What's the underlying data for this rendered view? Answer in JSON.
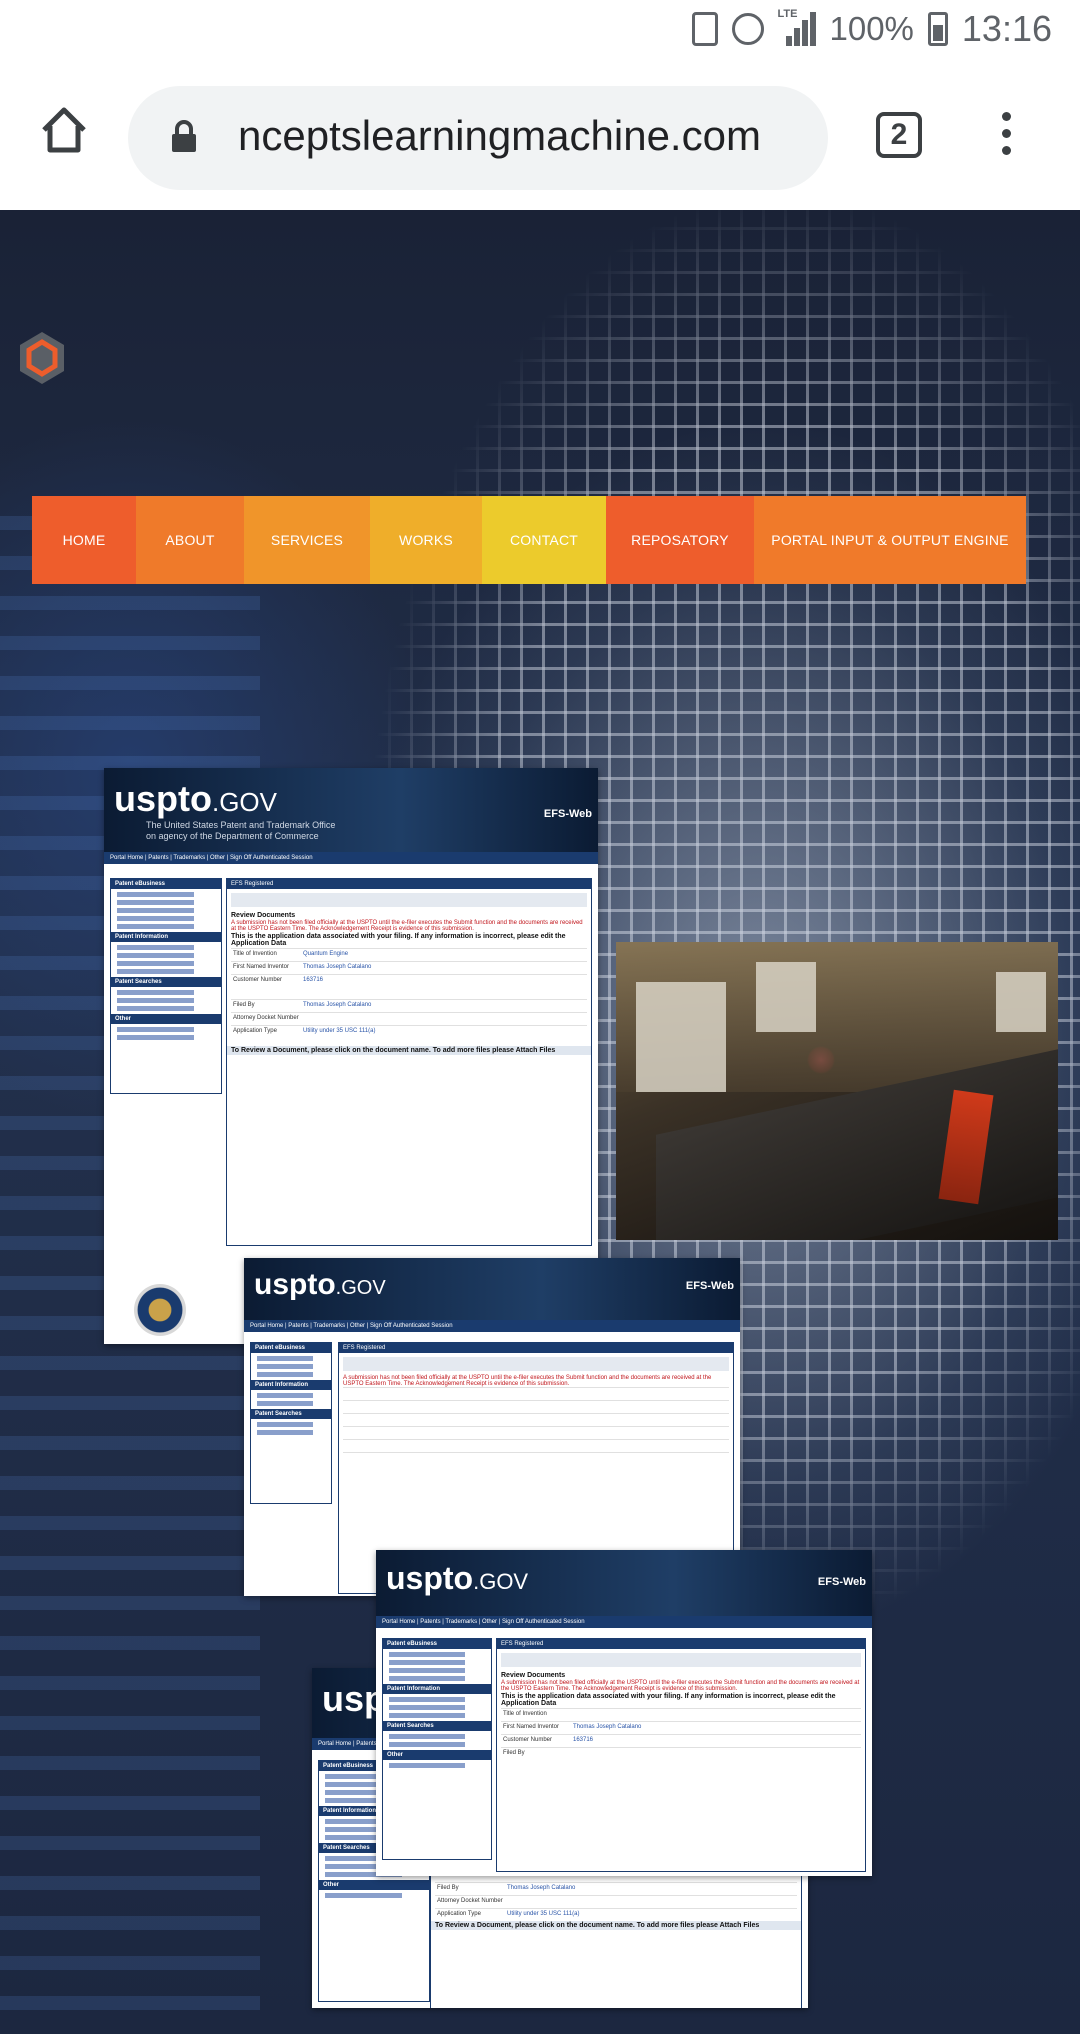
{
  "status_bar": {
    "lte_label": "LTE",
    "battery_pct": "100%",
    "time": "13:16"
  },
  "browser": {
    "url": "nceptslearningmachine.com",
    "tab_count": "2"
  },
  "nav": {
    "items": [
      {
        "label": "HOME",
        "color": "#ee5d2c"
      },
      {
        "label": "ABOUT",
        "color": "#ef7a2a"
      },
      {
        "label": "SERVICES",
        "color": "#f0952a"
      },
      {
        "label": "WORKS",
        "color": "#efae2a"
      },
      {
        "label": "CONTACT",
        "color": "#eccb2c"
      },
      {
        "label": "REPOSATORY",
        "color": "#ee5d2c"
      },
      {
        "label": "PORTAL INPUT & OUTPUT ENGINE",
        "color": "#f07a2a"
      }
    ]
  },
  "uspto": {
    "logo": "uspto",
    "logo_suffix": ".GOV",
    "subtitle": "The United States Patent and Trademark Office\non agency of the Department of Commerce",
    "efs": "EFS-Web",
    "nav_text": "Portal Home  |  Patents  |  Trademarks  |  Other  |  Sign Off Authenticated Session",
    "efs_registered": "EFS Registered",
    "review_documents": "Review Documents",
    "warning": "A submission has not been filed officially at the USPTO until the e-filer executes the Submit function and the documents are received at the USPTO Eastern Time. The Acknowledgement Receipt is evidence of this submission.",
    "intro": "This is the application data associated with your filing. If any information is incorrect, please edit the Application Data",
    "fields": [
      {
        "label": "Title of Invention",
        "value": "Quantum Engine"
      },
      {
        "label": "First Named Inventor",
        "value": "Thomas Joseph Catalano"
      },
      {
        "label": "Customer Number",
        "value": "163716"
      },
      {
        "label": "Filed By",
        "value": "Thomas Joseph Catalano"
      },
      {
        "label": "Attorney Docket Number",
        "value": ""
      },
      {
        "label": "Application Type",
        "value": "Utility under 35 USC 111(a)"
      }
    ],
    "review_prompt": "To Review a Document, please click on the document name. To add more files please Attach Files",
    "side_headers": [
      "Patent eBusiness",
      "Patent Information",
      "Patent Searches",
      "Other"
    ]
  }
}
